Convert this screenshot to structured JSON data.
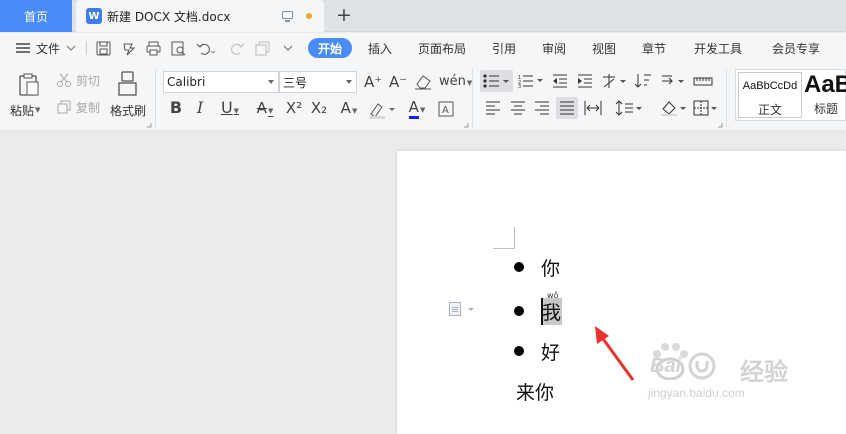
{
  "tabs": {
    "home": "首页",
    "doc_icon": "W",
    "doc_title": "新建 DOCX 文档.docx",
    "new_tab": "+"
  },
  "menubar": {
    "file_menu": "文件",
    "ribbon_tabs": [
      "开始",
      "插入",
      "页面布局",
      "引用",
      "审阅",
      "视图",
      "章节",
      "开发工具",
      "会员专享"
    ]
  },
  "ribbon": {
    "paste": "粘贴",
    "cut": "剪切",
    "copy": "复制",
    "format_painter": "格式刷",
    "font_name": "Calibri",
    "font_size": "三号",
    "style_normal_preview": "AaBbCcDd",
    "style_normal": "正文",
    "style_heading_preview": "AaB",
    "style_heading": "标题"
  },
  "document": {
    "bullets": [
      "你",
      "我",
      "好"
    ],
    "selected_pinyin": "wǒ",
    "plain_line": "来你"
  },
  "watermark": {
    "brand": "Bai",
    "brand_cn": "经验",
    "url": "jingyan.baidu.com"
  },
  "colors": {
    "accent": "#4a8cf7",
    "annotation_arrow": "#e8322a",
    "selection": "#c8c8c8"
  }
}
